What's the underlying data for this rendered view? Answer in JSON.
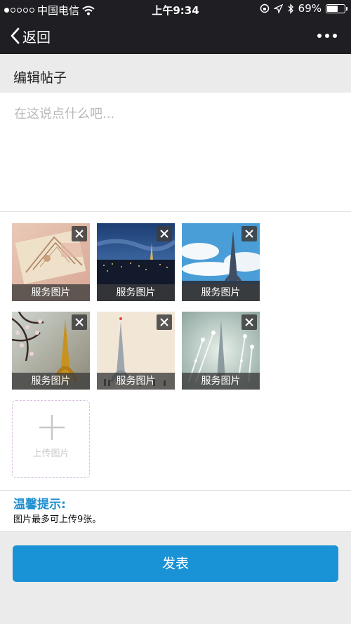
{
  "status_bar": {
    "carrier": "中国电信",
    "time": "上午9:34",
    "battery": "69%",
    "battery_level": 0.69
  },
  "nav": {
    "back_label": "返回"
  },
  "section": {
    "title": "编辑帖子"
  },
  "post": {
    "placeholder": "在这说点什么吧...",
    "value": ""
  },
  "images": [
    {
      "caption": "服务图片",
      "icon": "eiffel-tower-sketch-photo"
    },
    {
      "caption": "服务图片",
      "icon": "paris-night-skyline-photo"
    },
    {
      "caption": "服务图片",
      "icon": "eiffel-tower-blue-sky-photo"
    },
    {
      "caption": "服务图片",
      "icon": "eiffel-tower-blossom-photo"
    },
    {
      "caption": "服务图片",
      "icon": "eiffel-tower-cream-photo"
    },
    {
      "caption": "服务图片",
      "icon": "eiffel-tower-frost-photo"
    }
  ],
  "upload": {
    "label": "上传图片"
  },
  "tips": {
    "title": "温馨提示:",
    "text": "图片最多可上传9张。"
  },
  "submit": {
    "label": "发表"
  },
  "colors": {
    "nav_background": "#1f1e23",
    "accent": "#1a92d6",
    "tips_title": "#1f8fd0",
    "page_background": "#ebebeb"
  }
}
